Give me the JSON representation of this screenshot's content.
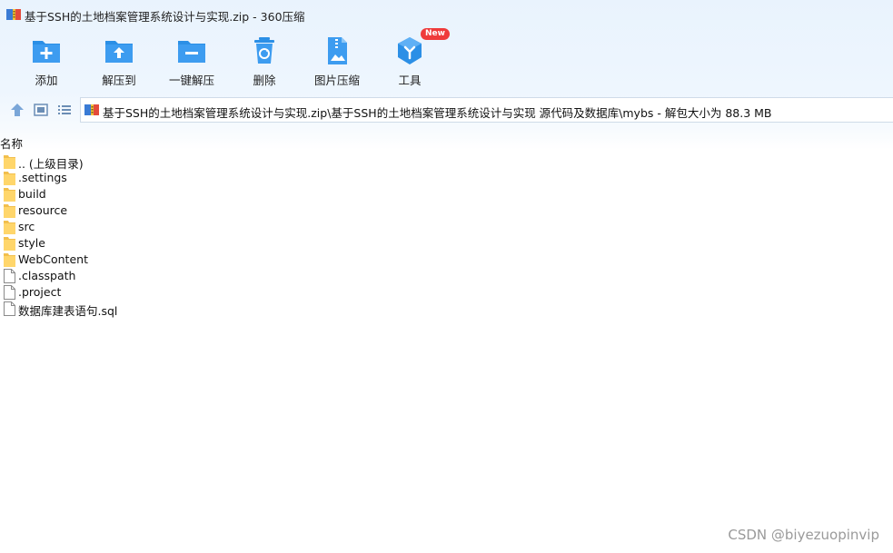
{
  "window": {
    "title": "基于SSH的土地档案管理系统设计与实现.zip - 360压缩"
  },
  "toolbar": {
    "items": [
      {
        "label": "添加",
        "icon": "add-folder-icon"
      },
      {
        "label": "解压到",
        "icon": "extract-to-icon"
      },
      {
        "label": "一键解压",
        "icon": "one-click-extract-icon"
      },
      {
        "label": "删除",
        "icon": "recycle-bin-icon"
      },
      {
        "label": "图片压缩",
        "icon": "image-compress-icon"
      },
      {
        "label": "工具",
        "icon": "tools-cube-icon",
        "badge": "New"
      }
    ]
  },
  "address": {
    "path": "基于SSH的土地档案管理系统设计与实现.zip\\基于SSH的土地档案管理系统设计与实现 源代码及数据库\\mybs - 解包大小为 88.3 MB"
  },
  "list": {
    "column_name": "名称",
    "items": [
      {
        "name": ".. (上级目录)",
        "type": "folder"
      },
      {
        "name": ".settings",
        "type": "folder"
      },
      {
        "name": "build",
        "type": "folder"
      },
      {
        "name": "resource",
        "type": "folder"
      },
      {
        "name": "src",
        "type": "folder"
      },
      {
        "name": "style",
        "type": "folder"
      },
      {
        "name": "WebContent",
        "type": "folder"
      },
      {
        "name": ".classpath",
        "type": "file"
      },
      {
        "name": ".project",
        "type": "file"
      },
      {
        "name": "数据库建表语句.sql",
        "type": "file"
      }
    ]
  },
  "watermark": "CSDN @biyezuopinvip",
  "colors": {
    "accent": "#2b8fe6",
    "folder": "#ffd66b",
    "badge": "#ef3b3b"
  }
}
